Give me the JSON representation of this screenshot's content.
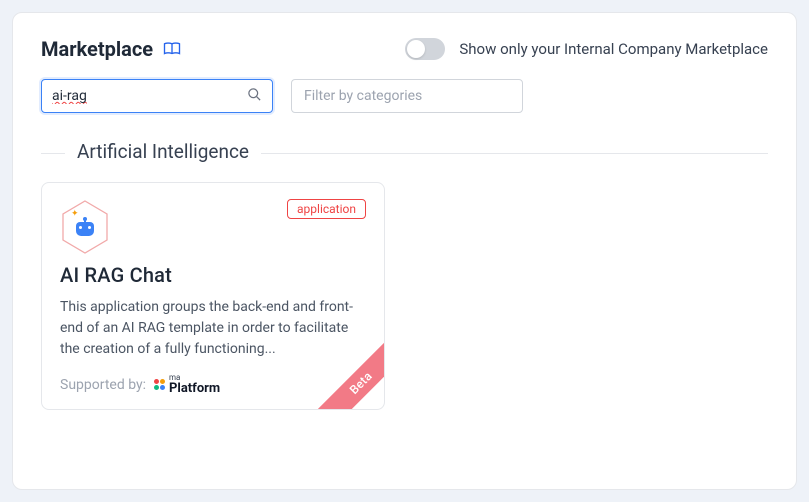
{
  "header": {
    "title": "Marketplace",
    "toggle_label": "Show only your Internal Company Marketplace",
    "toggle_on": false
  },
  "filters": {
    "search_value": "ai-rag",
    "search_placeholder": "",
    "category_placeholder": "Filter by categories"
  },
  "section": {
    "label": "Artificial Intelligence"
  },
  "card": {
    "badge": "application",
    "title": "AI RAG Chat",
    "description": "This application groups the back-end and front-end of an AI RAG template in order to facilitate the creation of a fully functioning...",
    "supported_by_label": "Supported by:",
    "platform_small": "ma",
    "platform_large": "Platform",
    "ribbon": "Beta"
  }
}
